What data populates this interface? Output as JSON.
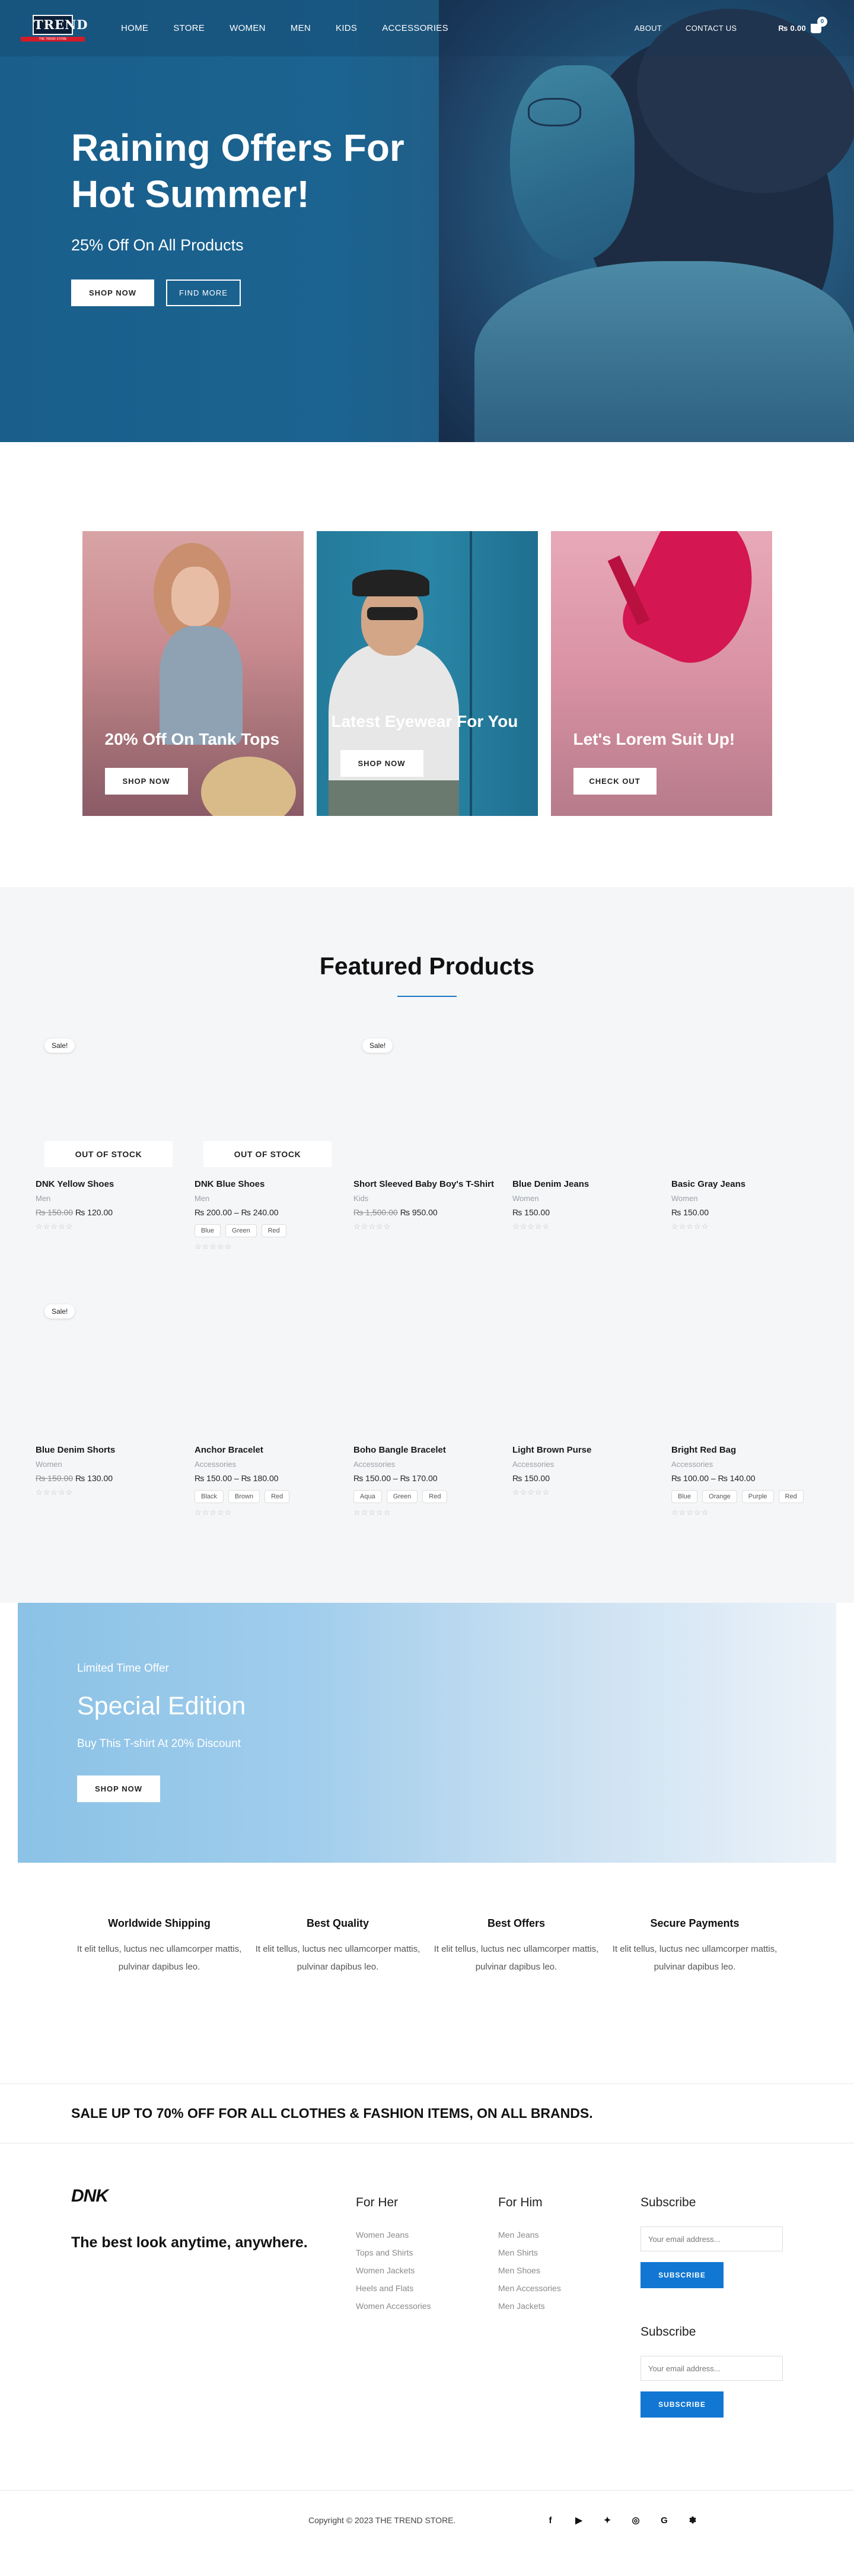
{
  "brand": {
    "logo_text": "TREND",
    "logo_tagline": "THE TREND STORE",
    "colors": {
      "primary": "#1977c5",
      "sale_red": "#d31b2a"
    }
  },
  "nav": {
    "items": [
      "HOME",
      "STORE",
      "WOMEN",
      "MEN",
      "KIDS",
      "ACCESSORIES"
    ],
    "right_items": [
      "ABOUT",
      "CONTACT US"
    ],
    "cart_total": "₨ 0.00",
    "cart_count": "0"
  },
  "hero": {
    "title": "Raining Offers For Hot Summer!",
    "subtitle": "25% Off On All Products",
    "primary_btn": "SHOP NOW",
    "secondary_btn": "FIND MORE"
  },
  "promos": [
    {
      "title": "20% Off On Tank Tops",
      "button": "SHOP NOW"
    },
    {
      "title": "Latest Eyewear For You",
      "button": "SHOP NOW"
    },
    {
      "title": "Let's Lorem Suit Up!",
      "button": "CHECK OUT"
    }
  ],
  "featured": {
    "title": "Featured Products",
    "products": [
      {
        "name": "DNK Yellow Shoes",
        "category": "Men",
        "old_price": "₨ 150.00",
        "price": "₨ 120.00",
        "sale": "Sale!",
        "out_of_stock": "OUT OF STOCK",
        "swatches": []
      },
      {
        "name": "DNK Blue Shoes",
        "category": "Men",
        "old_price": "",
        "price": "₨ 200.00 – ₨ 240.00",
        "sale": "",
        "out_of_stock": "OUT OF STOCK",
        "swatches": [
          "Blue",
          "Green",
          "Red"
        ]
      },
      {
        "name": "Short Sleeved Baby Boy's T-Shirt",
        "category": "Kids",
        "old_price": "₨ 1,500.00",
        "price": "₨ 950.00",
        "sale": "Sale!",
        "out_of_stock": "",
        "swatches": []
      },
      {
        "name": "Blue Denim Jeans",
        "category": "Women",
        "old_price": "",
        "price": "₨ 150.00",
        "sale": "",
        "out_of_stock": "",
        "swatches": []
      },
      {
        "name": "Basic Gray Jeans",
        "category": "Women",
        "old_price": "",
        "price": "₨ 150.00",
        "sale": "",
        "out_of_stock": "",
        "swatches": []
      },
      {
        "name": "Blue Denim Shorts",
        "category": "Women",
        "old_price": "₨ 150.00",
        "price": "₨ 130.00",
        "sale": "Sale!",
        "out_of_stock": "",
        "swatches": []
      },
      {
        "name": "Anchor Bracelet",
        "category": "Accessories",
        "old_price": "",
        "price": "₨ 150.00 – ₨ 180.00",
        "sale": "",
        "out_of_stock": "",
        "swatches": [
          "Black",
          "Brown",
          "Red"
        ]
      },
      {
        "name": "Boho Bangle Bracelet",
        "category": "Accessories",
        "old_price": "",
        "price": "₨ 150.00 – ₨ 170.00",
        "sale": "",
        "out_of_stock": "",
        "swatches": [
          "Aqua",
          "Green",
          "Red"
        ]
      },
      {
        "name": "Light Brown Purse",
        "category": "Accessories",
        "old_price": "",
        "price": "₨ 150.00",
        "sale": "",
        "out_of_stock": "",
        "swatches": []
      },
      {
        "name": "Bright Red Bag",
        "category": "Accessories",
        "old_price": "",
        "price": "₨ 100.00 – ₨ 140.00",
        "sale": "",
        "out_of_stock": "",
        "swatches": [
          "Blue",
          "Orange",
          "Purple",
          "Red"
        ]
      }
    ],
    "stars": "☆☆☆☆☆"
  },
  "special": {
    "eyebrow": "Limited Time Offer",
    "title": "Special Edition",
    "subtitle": "Buy This T-shirt At 20% Discount",
    "button": "SHOP NOW"
  },
  "features": [
    {
      "title": "Worldwide Shipping",
      "desc": "It elit tellus, luctus nec ullamcorper mattis, pulvinar dapibus leo."
    },
    {
      "title": "Best Quality",
      "desc": "It elit tellus, luctus nec ullamcorper mattis, pulvinar dapibus leo."
    },
    {
      "title": "Best Offers",
      "desc": "It elit tellus, luctus nec ullamcorper mattis, pulvinar dapibus leo."
    },
    {
      "title": "Secure Payments",
      "desc": "It elit tellus, luctus nec ullamcorper mattis, pulvinar dapibus leo."
    }
  ],
  "sale_banner": "SALE UP TO 70% OFF FOR ALL CLOTHES & FASHION ITEMS, ON ALL BRANDS.",
  "footer": {
    "logo": "DNK",
    "tagline": "The best look anytime, anywhere.",
    "for_her": {
      "title": "For Her",
      "links": [
        "Women Jeans",
        "Tops and Shirts",
        "Women Jackets",
        "Heels and Flats",
        "Women Accessories"
      ]
    },
    "for_him": {
      "title": "For Him",
      "links": [
        "Men Jeans",
        "Men Shirts",
        "Men Shoes",
        "Men Accessories",
        "Men Jackets"
      ]
    },
    "subscribe": {
      "title": "Subscribe",
      "placeholder": "Your email address...",
      "button": "SUBSCRIBE"
    },
    "copyright": "Copyright © 2023 THE TREND STORE.",
    "socials": [
      "facebook-icon",
      "youtube-icon",
      "twitter-icon",
      "instagram-icon",
      "google-icon",
      "yelp-icon"
    ]
  }
}
